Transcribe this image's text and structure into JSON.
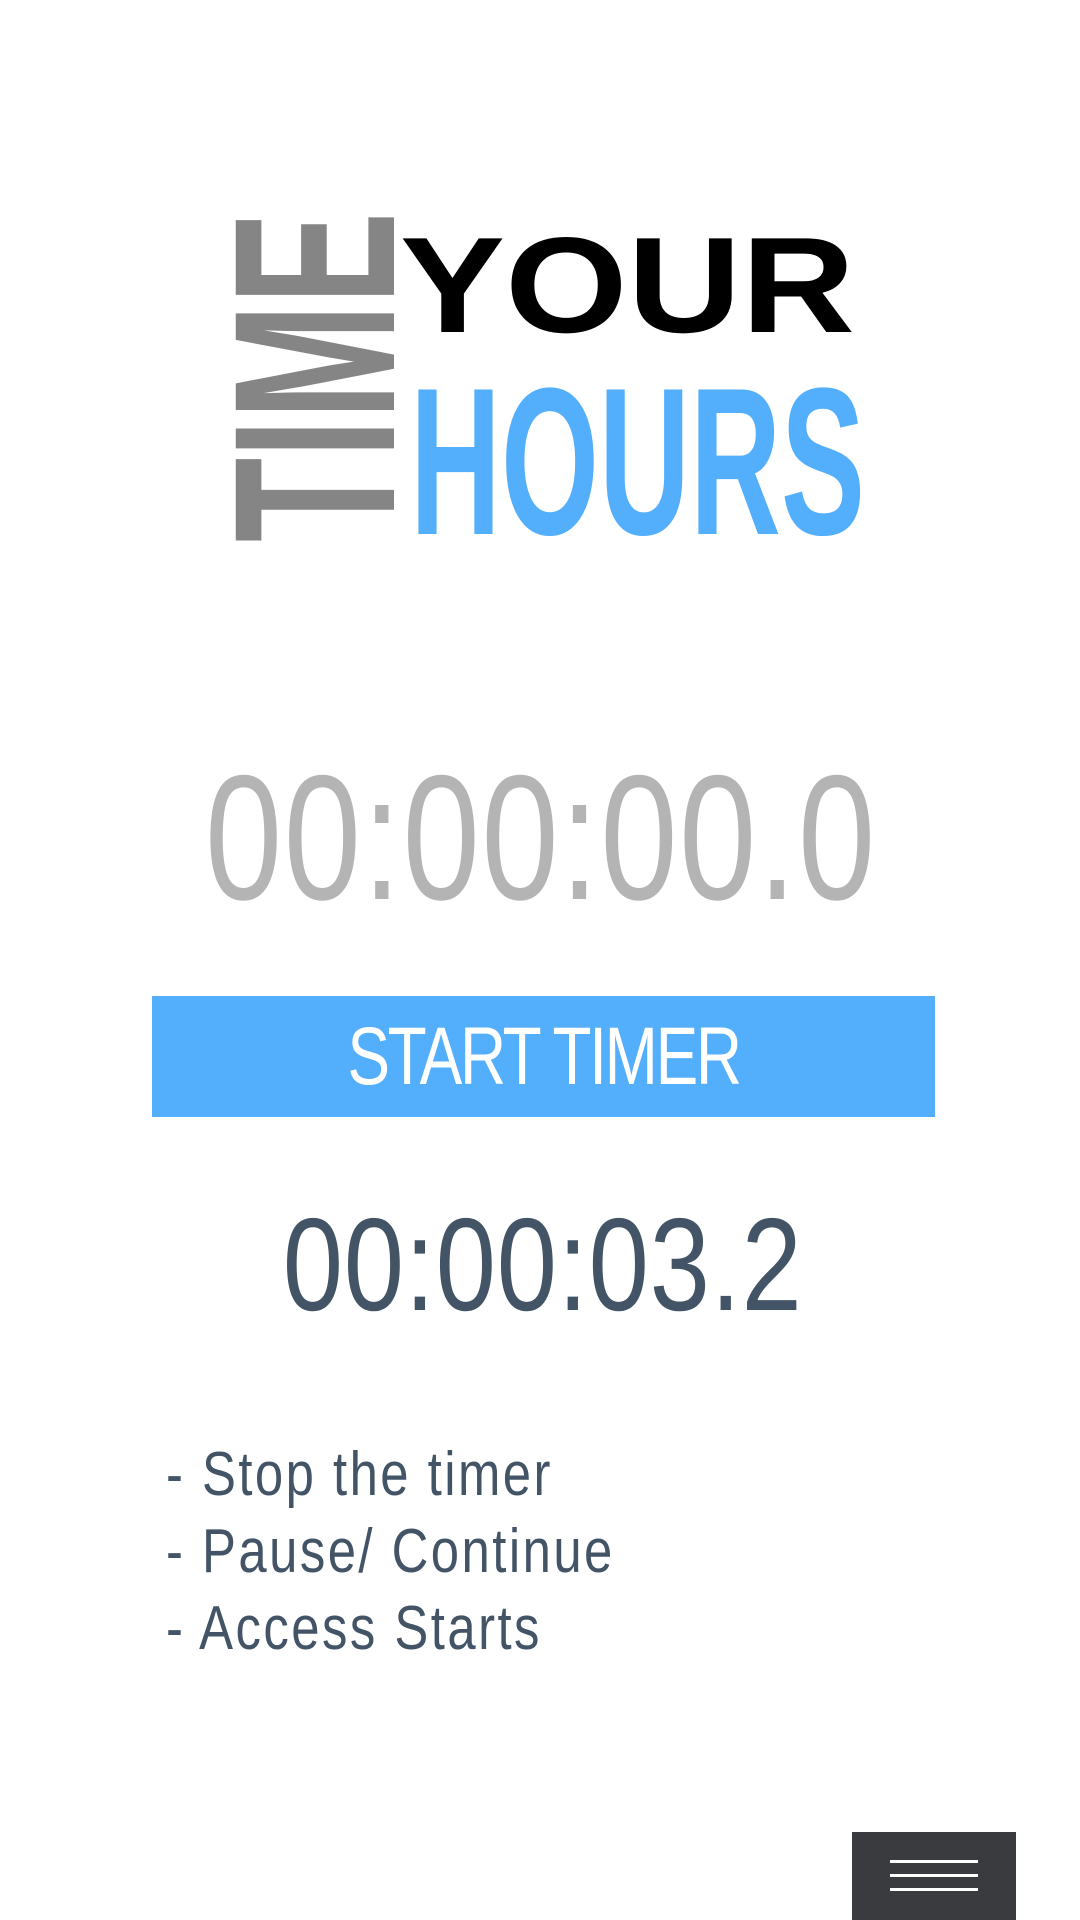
{
  "logo": {
    "word_time": "TIME",
    "word_your": "YOUR",
    "word_hours": "HOURS"
  },
  "timer": {
    "main_display": "00:00:00.0",
    "secondary_display": "00:00:03.2"
  },
  "start_button": {
    "label": "START TIMER"
  },
  "instructions": [
    "- Stop the timer",
    "- Pause/ Continue",
    "- Access Starts"
  ],
  "menu": {
    "icon": "hamburger-menu-icon"
  },
  "colors": {
    "accent": "#53aefb",
    "logo_gray": "#858585",
    "logo_black": "#000000",
    "main_timer": "#b4b4b4",
    "text_dark": "#435466",
    "menu_bg": "#3a3b3f"
  }
}
